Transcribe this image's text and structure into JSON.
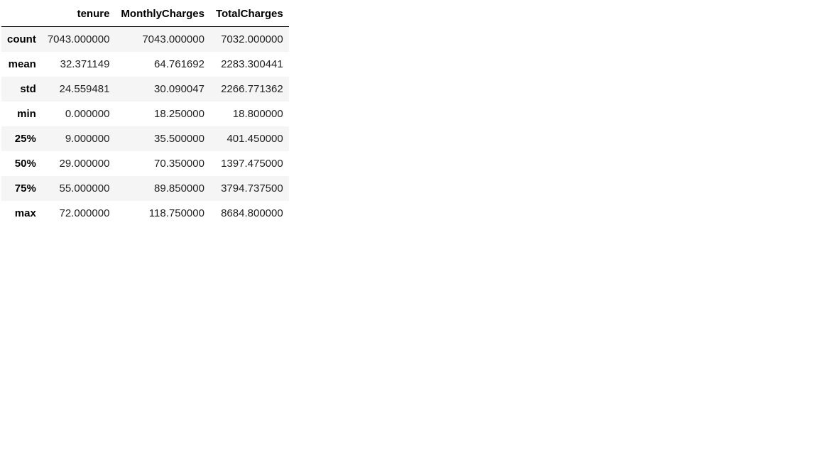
{
  "table": {
    "index_header": "",
    "columns": [
      "tenure",
      "MonthlyCharges",
      "TotalCharges"
    ],
    "rows": [
      {
        "label": "count",
        "values": [
          "7043.000000",
          "7043.000000",
          "7032.000000"
        ]
      },
      {
        "label": "mean",
        "values": [
          "32.371149",
          "64.761692",
          "2283.300441"
        ]
      },
      {
        "label": "std",
        "values": [
          "24.559481",
          "30.090047",
          "2266.771362"
        ]
      },
      {
        "label": "min",
        "values": [
          "0.000000",
          "18.250000",
          "18.800000"
        ]
      },
      {
        "label": "25%",
        "values": [
          "9.000000",
          "35.500000",
          "401.450000"
        ]
      },
      {
        "label": "50%",
        "values": [
          "29.000000",
          "70.350000",
          "1397.475000"
        ]
      },
      {
        "label": "75%",
        "values": [
          "55.000000",
          "89.850000",
          "3794.737500"
        ]
      },
      {
        "label": "max",
        "values": [
          "72.000000",
          "118.750000",
          "8684.800000"
        ]
      }
    ]
  },
  "colors": {
    "stripe": "#f5f5f5",
    "header_rule": "#000000"
  }
}
